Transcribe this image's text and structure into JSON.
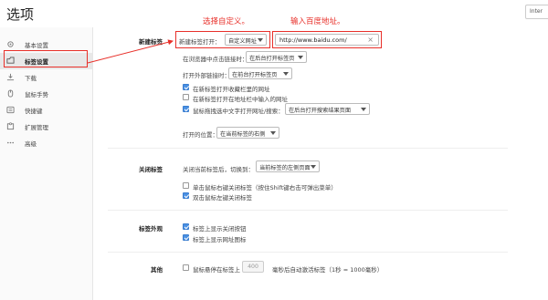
{
  "header": {
    "title": "选项",
    "search_text": "Inter"
  },
  "sidebar": {
    "items": [
      {
        "label": "基本设置",
        "icon": "gear-icon"
      },
      {
        "label": "标签设置",
        "icon": "tab-icon",
        "active": true
      },
      {
        "label": "下载",
        "icon": "download-icon"
      },
      {
        "label": "鼠标手势",
        "icon": "mouse-icon"
      },
      {
        "label": "快捷键",
        "icon": "keyboard-icon"
      },
      {
        "label": "扩展管理",
        "icon": "puzzle-icon"
      },
      {
        "label": "高级",
        "icon": "more-icon"
      }
    ]
  },
  "annotations": {
    "choose_custom": "选择自定义。",
    "enter_baidu": "输入百度地址。",
    "color": "#e8302a"
  },
  "new_tab": {
    "section": "新建标签",
    "open_label": "新建标签打开：",
    "open_value": "自定义网址",
    "url_value": "http://www.baidu.com/",
    "browser_click_label": "在浏览器中点击链接时：",
    "browser_click_value": "在后台打开标签页",
    "external_label": "打开外部链接时：",
    "external_value": "在前台打开标签页",
    "cb_favorites": "在新标签打开收藏栏里的网址",
    "cb_addressbar": "在新标签打开在地址栏中输入的网址",
    "cb_drag": "鼠标拖拽选中文字打开网址/搜索：",
    "drag_value": "在后台打开搜索结果页面",
    "position_label": "打开的位置：",
    "position_value": "在当前标签的右侧"
  },
  "close_tab": {
    "section": "关闭标签",
    "switch_label": "关闭当前标签后，切换到：",
    "switch_value": "当前标签的左侧页面",
    "cb_right_click": "单击鼠标右键关闭标签（按住Shift键右击可弹出菜单）",
    "cb_double_click": "双击鼠标左键关闭标签"
  },
  "tab_appearance": {
    "section": "标签外观",
    "cb_close_btn": "标签上显示关闭按钮",
    "cb_favicon": "标签上显示网址图标"
  },
  "other": {
    "section": "其他",
    "cb_hover_prefix": "鼠标悬停在标签上",
    "hover_ms": "400",
    "cb_hover_suffix": "毫秒后自动激活标签（1秒 = 1000毫秒）"
  }
}
